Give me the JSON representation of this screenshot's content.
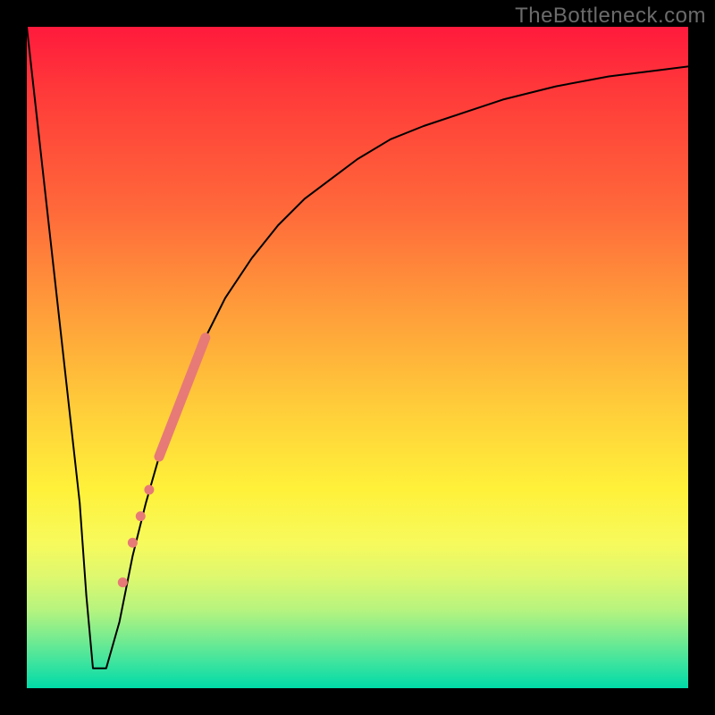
{
  "watermark": "TheBottleneck.com",
  "colors": {
    "frame": "#000000",
    "curve": "#000000",
    "marker": "#e77a76",
    "gradient_stops": [
      "#ff1a3c",
      "#ff3a3a",
      "#ff6a3a",
      "#ff9a3a",
      "#ffce3a",
      "#fff13a",
      "#f7fa5c",
      "#dff86e",
      "#b8f47e",
      "#7eec8e",
      "#3fe49e",
      "#00dba8"
    ]
  },
  "chart_data": {
    "type": "line",
    "title": "",
    "xlabel": "",
    "ylabel": "",
    "xlim": [
      0,
      100
    ],
    "ylim": [
      0,
      100
    ],
    "background": "vertical-gradient red→green (bottleneck heatmap)",
    "series": [
      {
        "name": "bottleneck-curve",
        "x": [
          0,
          2,
          4,
          6,
          8,
          9,
          10,
          11,
          12,
          14,
          16,
          18,
          20,
          22,
          24,
          26,
          28,
          30,
          34,
          38,
          42,
          46,
          50,
          55,
          60,
          66,
          72,
          80,
          88,
          96,
          100
        ],
        "y": [
          100,
          82,
          64,
          46,
          28,
          14,
          3,
          3,
          3,
          10,
          20,
          28,
          35,
          41,
          46,
          51,
          55,
          59,
          65,
          70,
          74,
          77,
          80,
          83,
          85,
          87,
          89,
          91,
          92.5,
          93.5,
          94
        ]
      }
    ],
    "markers": {
      "band": {
        "x_start": 20,
        "y_start": 35,
        "x_end": 27,
        "y_end": 53
      },
      "dots": [
        {
          "x": 18.5,
          "y": 30
        },
        {
          "x": 17.2,
          "y": 26
        },
        {
          "x": 16.0,
          "y": 22
        },
        {
          "x": 14.5,
          "y": 16
        }
      ]
    }
  }
}
